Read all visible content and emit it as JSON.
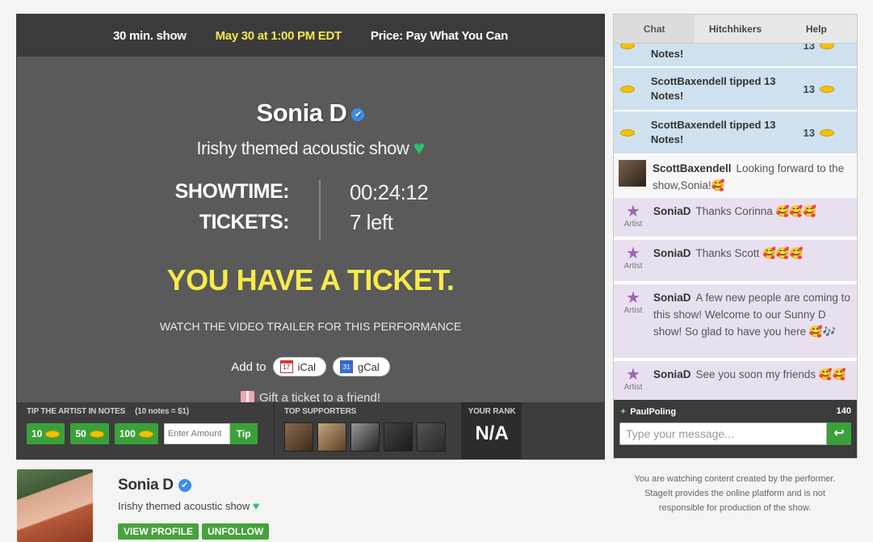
{
  "stage": {
    "duration": "30 min. show",
    "date": "May 30 at 1:00 PM EDT",
    "price": "Price: Pay What You Can",
    "artist_name": "Sonia D",
    "tagline": "Irishy themed acoustic show",
    "showtime_label": "SHOWTIME:",
    "showtime_value": "00:24:12",
    "tickets_label": "TICKETS:",
    "tickets_value": "7 left",
    "have_ticket": "YOU HAVE A TICKET.",
    "trailer_link": "WATCH THE VIDEO TRAILER FOR THIS PERFORMANCE",
    "add_to": "Add to",
    "ical": "iCal",
    "gcal": "gCal",
    "ical_icon_text": "17",
    "gcal_icon_text": "31",
    "gift": "Gift a ticket to a friend!"
  },
  "tip": {
    "label": "TIP THE ARTIST IN NOTES",
    "rate": "(10 notes = $1)",
    "options": [
      "10",
      "50",
      "100"
    ],
    "placeholder": "Enter Amount",
    "submit": "Tip"
  },
  "supporters": {
    "label": "TOP SUPPORTERS"
  },
  "rank": {
    "label": "YOUR RANK",
    "value": "N/A"
  },
  "chat": {
    "tabs": [
      "Chat",
      "Hitchhikers",
      "Help"
    ],
    "tip_messages": [
      {
        "text": "Notes!",
        "amount": "13"
      },
      {
        "text": "ScottBaxendell tipped 13 Notes!",
        "amount": "13"
      },
      {
        "text": "ScottBaxendell tipped 13 Notes!",
        "amount": "13"
      }
    ],
    "fan_message": {
      "user": "ScottBaxendell",
      "text": "Looking forward to the show,Sonia!🥰"
    },
    "artist_label": "Artist",
    "artist_messages": [
      {
        "user": "SoniaD",
        "text": "Thanks Corinna 🥰🥰🥰"
      },
      {
        "user": "SoniaD",
        "text": "Thanks Scott 🥰🥰🥰"
      },
      {
        "user": "SoniaD",
        "text": "A few new people are coming to this show! Welcome to our Sunny D show! So glad to have you here 🥰🎶"
      },
      {
        "user": "SoniaD",
        "text": "See you soon my friends 🥰🥰"
      }
    ],
    "viewer_name": "PaulPoling",
    "viewer_count": "140",
    "input_placeholder": "Type your message..."
  },
  "profile": {
    "name": "Sonia D",
    "tagline": "Irishy themed acoustic show",
    "view_profile": "VIEW PROFILE",
    "unfollow": "UNFOLLOW"
  },
  "disclaimer": "You are watching content created by the performer. StageIt provides the online platform and is not responsible for production of the show.",
  "colors": {
    "accent_yellow": "#f7ea4a",
    "green": "#3aa13a",
    "tip_bg": "#cfe1ee",
    "artist_bg": "#e8e0ef"
  }
}
